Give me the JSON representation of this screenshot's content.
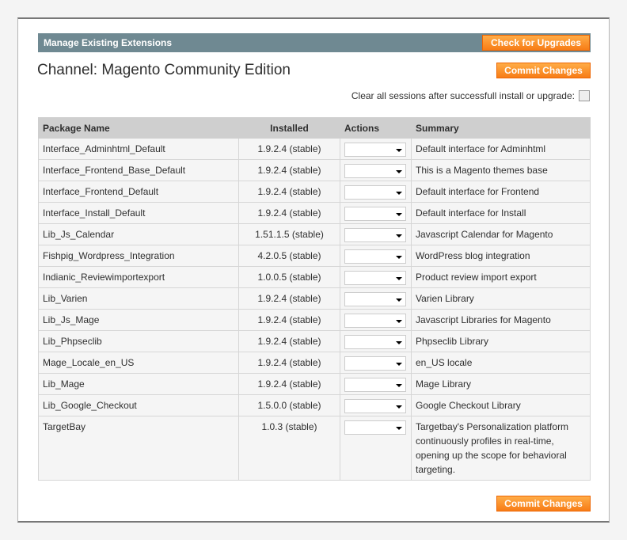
{
  "header": {
    "title": "Manage Existing Extensions",
    "check_upgrades": "Check for Upgrades"
  },
  "channel": "Channel: Magento Community Edition",
  "commit": "Commit Changes",
  "clear_sessions": "Clear all sessions after successfull install or upgrade:",
  "columns": [
    "Package Name",
    "Installed",
    "Actions",
    "Summary"
  ],
  "rows": [
    {
      "name": "Interface_Adminhtml_Default",
      "installed": "1.9.2.4 (stable)",
      "summary": "Default interface for Adminhtml"
    },
    {
      "name": "Interface_Frontend_Base_Default",
      "installed": "1.9.2.4 (stable)",
      "summary": "This is a Magento themes base"
    },
    {
      "name": "Interface_Frontend_Default",
      "installed": "1.9.2.4 (stable)",
      "summary": "Default interface for Frontend"
    },
    {
      "name": "Interface_Install_Default",
      "installed": "1.9.2.4 (stable)",
      "summary": "Default interface for Install"
    },
    {
      "name": "Lib_Js_Calendar",
      "installed": "1.51.1.5 (stable)",
      "summary": "Javascript Calendar for Magento"
    },
    {
      "name": "Fishpig_Wordpress_Integration",
      "installed": "4.2.0.5 (stable)",
      "summary": "WordPress blog integration"
    },
    {
      "name": "Indianic_Reviewimportexport",
      "installed": "1.0.0.5 (stable)",
      "summary": "Product review import export"
    },
    {
      "name": "Lib_Varien",
      "installed": "1.9.2.4 (stable)",
      "summary": "Varien Library"
    },
    {
      "name": "Lib_Js_Mage",
      "installed": "1.9.2.4 (stable)",
      "summary": "Javascript Libraries for Magento"
    },
    {
      "name": "Lib_Phpseclib",
      "installed": "1.9.2.4 (stable)",
      "summary": "Phpseclib Library"
    },
    {
      "name": "Mage_Locale_en_US",
      "installed": "1.9.2.4 (stable)",
      "summary": "en_US locale"
    },
    {
      "name": "Lib_Mage",
      "installed": "1.9.2.4 (stable)",
      "summary": "Mage Library"
    },
    {
      "name": "Lib_Google_Checkout",
      "installed": "1.5.0.0 (stable)",
      "summary": "Google Checkout Library"
    },
    {
      "name": "TargetBay",
      "installed": "1.0.3 (stable)",
      "summary": "Targetbay's Personalization platform continuously profiles in real-time, opening up the scope for behavioral targeting."
    }
  ]
}
